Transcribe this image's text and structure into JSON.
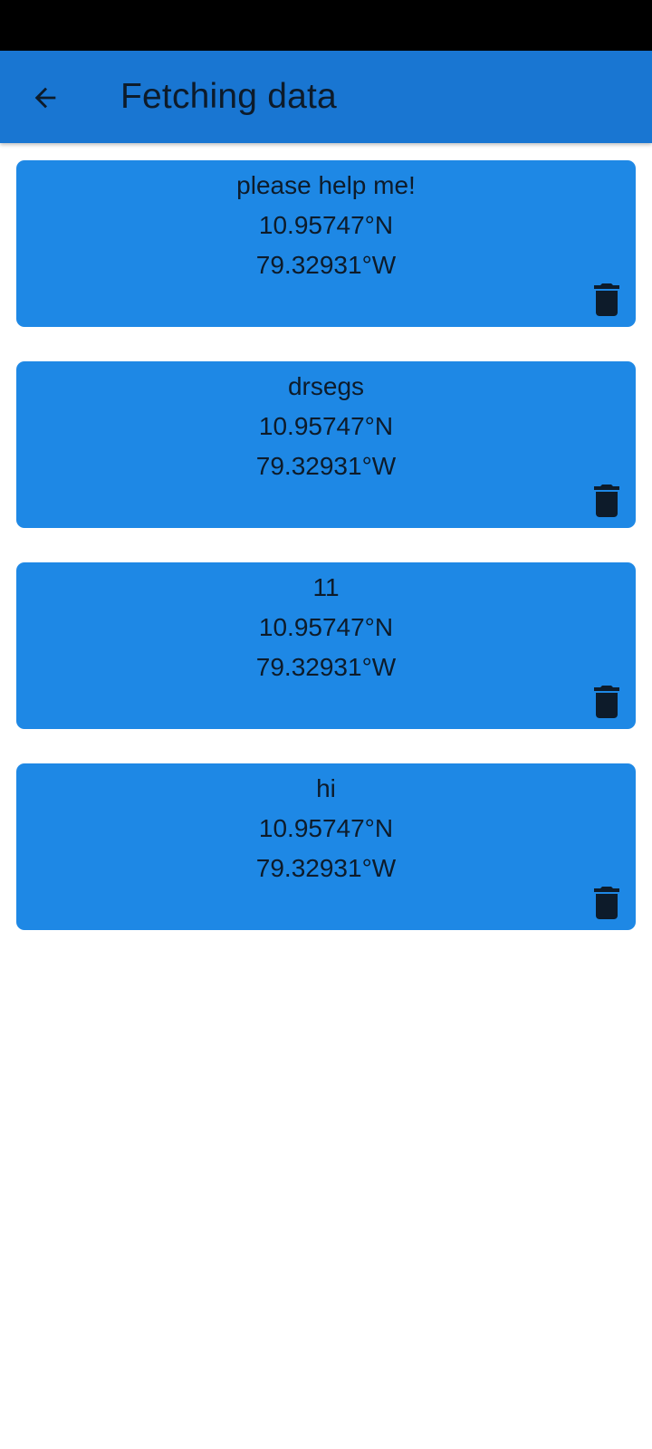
{
  "app_bar": {
    "title": "Fetching data",
    "back_icon": "arrow-back-icon"
  },
  "colors": {
    "app_bar": "#1976d2",
    "card": "#1e88e5",
    "text": "#0d1b2a",
    "status_bar": "#000000"
  },
  "entries": [
    {
      "message": "please help me!",
      "latitude": "10.95747°N",
      "longitude": "79.32931°W",
      "delete_icon": "trash-icon"
    },
    {
      "message": "drsegs",
      "latitude": "10.95747°N",
      "longitude": "79.32931°W",
      "delete_icon": "trash-icon"
    },
    {
      "message": "11",
      "latitude": "10.95747°N",
      "longitude": "79.32931°W",
      "delete_icon": "trash-icon"
    },
    {
      "message": "hi",
      "latitude": "10.95747°N",
      "longitude": "79.32931°W",
      "delete_icon": "trash-icon"
    }
  ]
}
